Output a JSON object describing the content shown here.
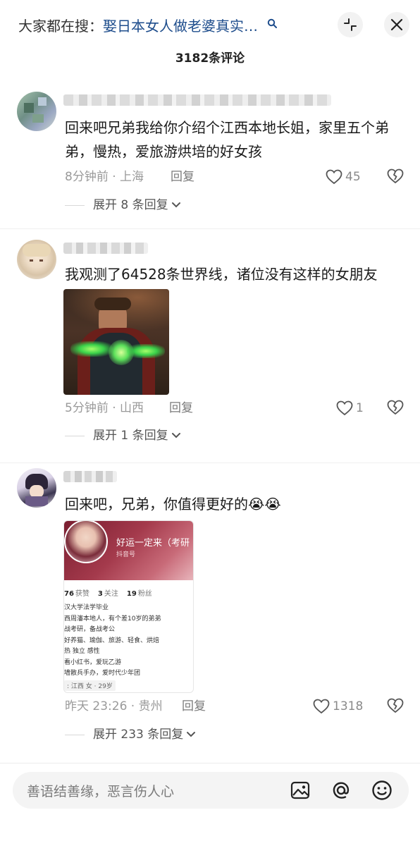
{
  "header": {
    "search_prefix": "大家都在搜：",
    "search_query": "娶日本女人做老婆真实…",
    "comment_count": "3182条评论"
  },
  "comments": [
    {
      "text": "回来吧兄弟我给你介绍个江西本地长姐，家里五个弟弟，慢热，爱旅游烘培的好女孩",
      "time_location": "8分钟前 · 上海",
      "reply_label": "回复",
      "likes": "45",
      "expand_label": "展开 8 条回复"
    },
    {
      "text": "我观测了64528条世界线，诸位没有这样的女朋友",
      "time_location": "5分钟前 · 山西",
      "reply_label": "回复",
      "likes": "1",
      "expand_label": "展开 1 条回复"
    },
    {
      "text": "回来吧，兄弟，你值得更好的😭😭",
      "time_location": "昨天 23:26 · 贵州",
      "reply_label": "回复",
      "likes": "1318",
      "expand_label": "展开 233 条回复",
      "embedded_profile": {
        "name": "好运一定来（考研",
        "sub": "抖音号",
        "stats": [
          {
            "num": "76",
            "label": "获赞"
          },
          {
            "num": "3",
            "label": "关注"
          },
          {
            "num": "19",
            "label": "粉丝"
          }
        ],
        "bio_lines": [
          "汉大学法学毕业",
          "西周瀋本地人，有个差10岁的弟弟",
          "战考研，备战考公",
          "好养猫、瑜伽、旅游、轻食、烘焙",
          "热  独立  感性",
          "看小红书，爱玩乙游",
          "墙散兵手办，爱时代少年团"
        ],
        "tags": ": 江西   女 · 29岁"
      }
    }
  ],
  "input": {
    "placeholder": "善语结善缘，恶言伤人心"
  },
  "icons": [
    "search-icon",
    "collapse-icon",
    "close-icon",
    "heart-icon",
    "broken-heart-icon",
    "chevron-down-icon",
    "image-icon",
    "mention-icon",
    "emoji-icon"
  ]
}
